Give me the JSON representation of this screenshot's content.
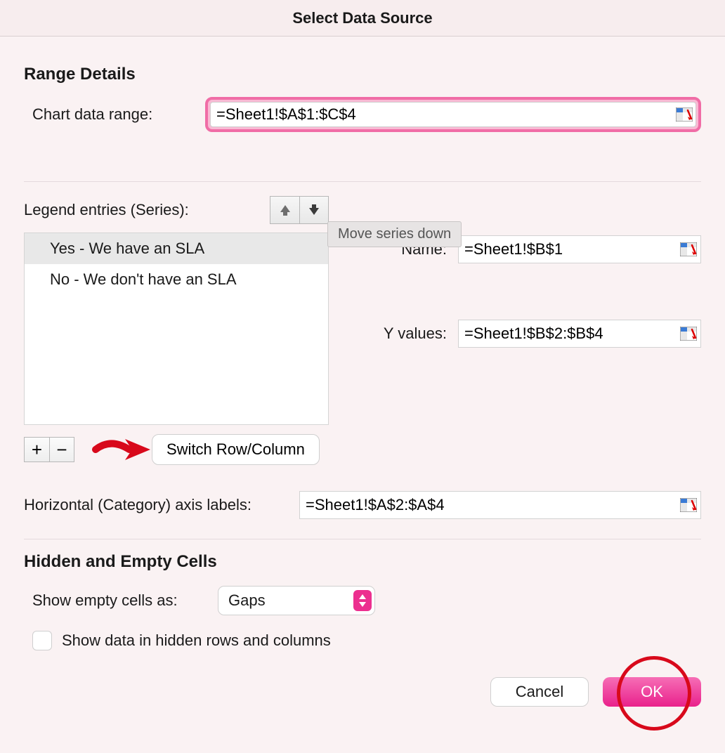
{
  "title": "Select Data Source",
  "rangeDetails": {
    "heading": "Range Details",
    "chartDataRangeLabel": "Chart data range:",
    "chartDataRangeValue": "=Sheet1!$A$1:$C$4"
  },
  "legend": {
    "title": "Legend entries (Series):",
    "tooltip": "Move series down",
    "series": [
      {
        "label": "Yes - We have an SLA",
        "selected": true
      },
      {
        "label": "No - We don't have an SLA",
        "selected": false
      }
    ],
    "nameLabel": "Name:",
    "nameValue": "=Sheet1!$B$1",
    "yLabel": "Y values:",
    "yValue": "=Sheet1!$B$2:$B$4",
    "switchLabel": "Switch Row/Column",
    "axisLabel": "Horizontal (Category) axis labels:",
    "axisValue": "=Sheet1!$A$2:$A$4"
  },
  "hidden": {
    "heading": "Hidden and Empty Cells",
    "emptyLabel": "Show empty cells as:",
    "emptyValue": "Gaps",
    "hiddenRowsLabel": "Show data in hidden rows and columns"
  },
  "buttons": {
    "cancel": "Cancel",
    "ok": "OK"
  }
}
